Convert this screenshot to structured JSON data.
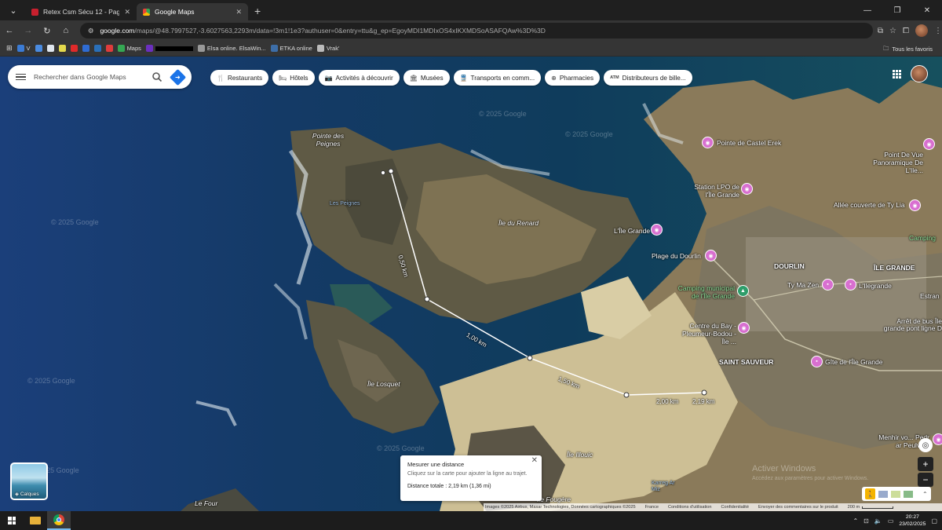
{
  "browser": {
    "tabs": [
      {
        "title": "Retex Csm Sécu 12 - Page 2 - K",
        "active": false
      },
      {
        "title": "Google Maps",
        "active": true
      }
    ],
    "new_tab": "+",
    "window_controls": [
      "—",
      "❐",
      "✕"
    ],
    "url_host": "google.com",
    "url_path": "/maps/@48.7997527,-3.6027563,2293m/data=!3m1!1e3?authuser=0&entry=ttu&g_ep=EgoyMDI1MDIxOS4xIKXMDSoASAFQAw%3D%3D",
    "bookmarks": [
      {
        "label": "V",
        "color": "#3b7bd4"
      },
      {
        "label": "",
        "color": "#4a8be0"
      },
      {
        "label": "",
        "color": "#dfe6ee"
      },
      {
        "label": "",
        "color": "#e4d94c"
      },
      {
        "label": "",
        "color": "#e02a2a"
      },
      {
        "label": "",
        "color": "#2f6cd3"
      },
      {
        "label": "",
        "color": "#2a6fb8"
      },
      {
        "label": "",
        "color": "#e03c3c"
      },
      {
        "label": "Maps",
        "color": "#35a853"
      },
      {
        "label": "",
        "color": "#6b2fbf"
      },
      {
        "label": "Elsa online. ElsaWin...",
        "color": "#999999"
      },
      {
        "label": "ETKA online",
        "color": "#3d6ea8"
      },
      {
        "label": "Vrak'",
        "color": "#bbbbbb"
      }
    ],
    "all_bookmarks": "Tous les favoris"
  },
  "maps": {
    "search_placeholder": "Rechercher dans Google Maps",
    "chips": [
      {
        "icon": "restaurant-icon",
        "glyph": "🍴",
        "label": "Restaurants"
      },
      {
        "icon": "hotel-icon",
        "glyph": "🛏",
        "label": "Hôtels"
      },
      {
        "icon": "camera-icon",
        "glyph": "📷",
        "label": "Activités à découvrir"
      },
      {
        "icon": "museum-icon",
        "glyph": "🏛",
        "label": "Musées"
      },
      {
        "icon": "transit-icon",
        "glyph": "🚆",
        "label": "Transports en comm..."
      },
      {
        "icon": "pharmacy-icon",
        "glyph": "⊕",
        "label": "Pharmacies"
      },
      {
        "icon": "atm-icon",
        "glyph": "ATM",
        "label": "Distributeurs de bille..."
      }
    ],
    "labels": {
      "pointe_peignes": "Pointe des Peignes",
      "les_peignes": "Les Peignes",
      "ile_du_renard": "Île du Renard",
      "ile_losquet": "Île Losquet",
      "ile_illouic": "Île Illouic",
      "le_four": "Le Four",
      "ile_fougere": "Île Fougère",
      "karreg": "Karreg Ar Miz",
      "castel_erek": "Pointe de Castel Erek",
      "station_lpo": "Station LPO de l'Île Grande",
      "ile_grande_poi": "L'Île Grande",
      "plage_dourlin": "Plage du Dourlin",
      "camping": "Camping municipal de l'Île Grande",
      "centre_bay": "Centre du Bay - Pleumeur-Bodou - Île ...",
      "dourlin": "DOURLIN",
      "ty_ma_zen": "Ty Ma Zen",
      "lilegrande": "L'Ilegrande",
      "ile_grande": "ÎLE GRANDE",
      "saint_sauveur": "SAINT SAUVEUR",
      "gite": "Gîte de l'Île Grande",
      "panoramique": "Point De Vue Panoramique De L'Ile...",
      "allee_couverte": "Allée couverte de Ty Lia",
      "camping_edge": "Camping",
      "estran": "Estran",
      "arret_bus": "Arrêt de bus Île grande pont ligne D",
      "menhir": "Menhir vo... Pedr ar Peulve...",
      "windows_activation": "Activer Windows",
      "windows_activation_sub": "Accédez aux paramètres pour activer Windows."
    },
    "watermarks": [
      "© 2025 Google",
      "© 2025 Google",
      "© 2025 Google",
      "© 2025 Google",
      "© 2025 Google",
      "© 2025 Google"
    ],
    "measure_labels": [
      "0,50 km",
      "1,00 km",
      "1,50 km",
      "2,00 km",
      "2,19 km"
    ],
    "measure_panel": {
      "title": "Mesurer une distance",
      "hint": "Cliquez sur la carte pour ajouter la ligne au trajet.",
      "total": "Distance totale : 2,19 km (1,36 mi)"
    },
    "layers_label": "Calques",
    "footer": {
      "imagery": "Images ©2025 Airbus, Maxar Technologies, Données cartographiques ©2025",
      "country": "France",
      "terms": "Conditions d'utilisation",
      "privacy": "Confidentialité",
      "feedback": "Envoyer des commentaires sur le produit",
      "scale": "200 m"
    }
  },
  "taskbar": {
    "time": "20:27",
    "date": "23/02/2025"
  }
}
